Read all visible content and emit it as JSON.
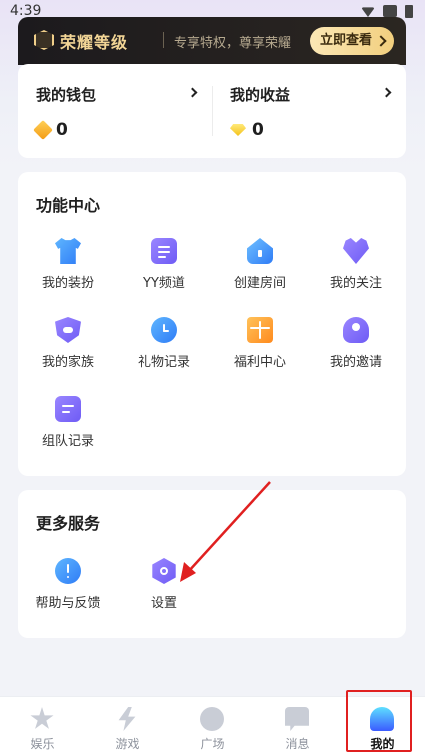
{
  "status_bar": {
    "time": "4:39"
  },
  "honor_banner": {
    "brand": "荣耀等级",
    "slogan": "专享特权，尊享荣耀",
    "cta": "立即查看"
  },
  "wallet": {
    "left": {
      "title": "我的钱包",
      "value": "0"
    },
    "right": {
      "title": "我的收益",
      "value": "0"
    }
  },
  "function_center": {
    "title": "功能中心",
    "items": [
      {
        "label": "我的装扮",
        "icon": "shirt-icon"
      },
      {
        "label": "YY频道",
        "icon": "channel-icon"
      },
      {
        "label": "创建房间",
        "icon": "house-icon"
      },
      {
        "label": "我的关注",
        "icon": "heart-icon"
      },
      {
        "label": "我的家族",
        "icon": "family-shield-icon"
      },
      {
        "label": "礼物记录",
        "icon": "clock-icon"
      },
      {
        "label": "福利中心",
        "icon": "gift-icon"
      },
      {
        "label": "我的邀请",
        "icon": "invite-person-icon"
      },
      {
        "label": "组队记录",
        "icon": "team-record-icon"
      }
    ]
  },
  "more_services": {
    "title": "更多服务",
    "items": [
      {
        "label": "帮助与反馈",
        "icon": "help-icon"
      },
      {
        "label": "设置",
        "icon": "settings-icon"
      }
    ]
  },
  "tab_bar": {
    "tabs": [
      {
        "label": "娱乐",
        "icon": "star-icon"
      },
      {
        "label": "游戏",
        "icon": "game-bolt-icon"
      },
      {
        "label": "广场",
        "icon": "compass-icon"
      },
      {
        "label": "消息",
        "icon": "message-icon"
      },
      {
        "label": "我的",
        "icon": "me-ghost-icon",
        "active": true
      }
    ]
  },
  "colors": {
    "accent_gold": "#f2cf7e",
    "highlight_red": "#e02020",
    "violet": "#6e5bf5",
    "blue": "#2f7cf6"
  }
}
